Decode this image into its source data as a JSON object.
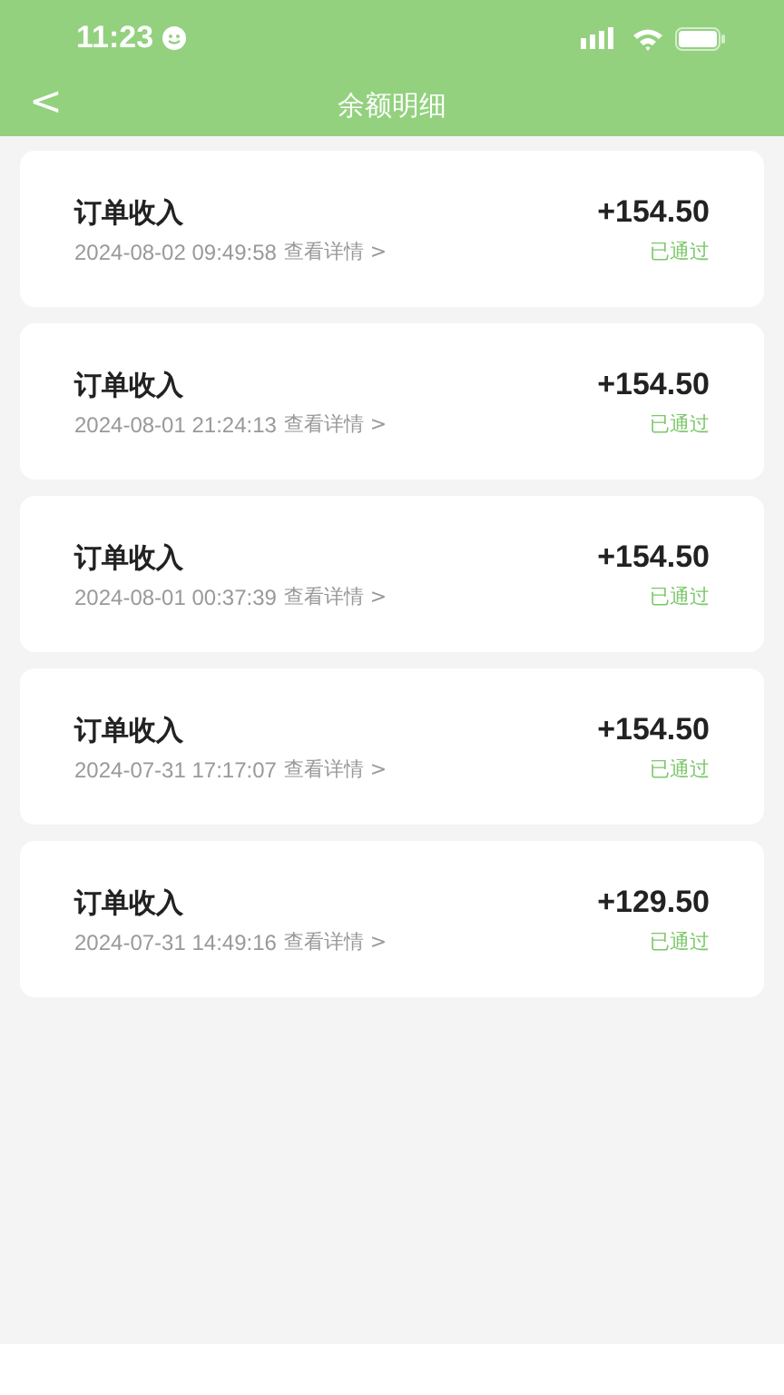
{
  "status_bar": {
    "time": "11:23"
  },
  "nav": {
    "back": "<",
    "title": "余额明细"
  },
  "records": [
    {
      "title": "订单收入",
      "datetime": "2024-08-02 09:49:58",
      "link": "查看详情 >",
      "amount": "+154.50",
      "status": "已通过"
    },
    {
      "title": "订单收入",
      "datetime": "2024-08-01 21:24:13",
      "link": "查看详情 >",
      "amount": "+154.50",
      "status": "已通过"
    },
    {
      "title": "订单收入",
      "datetime": "2024-08-01 00:37:39",
      "link": "查看详情 >",
      "amount": "+154.50",
      "status": "已通过"
    },
    {
      "title": "订单收入",
      "datetime": "2024-07-31 17:17:07",
      "link": "查看详情 >",
      "amount": "+154.50",
      "status": "已通过"
    },
    {
      "title": "订单收入",
      "datetime": "2024-07-31 14:49:16",
      "link": "查看详情 >",
      "amount": "+129.50",
      "status": "已通过"
    }
  ]
}
